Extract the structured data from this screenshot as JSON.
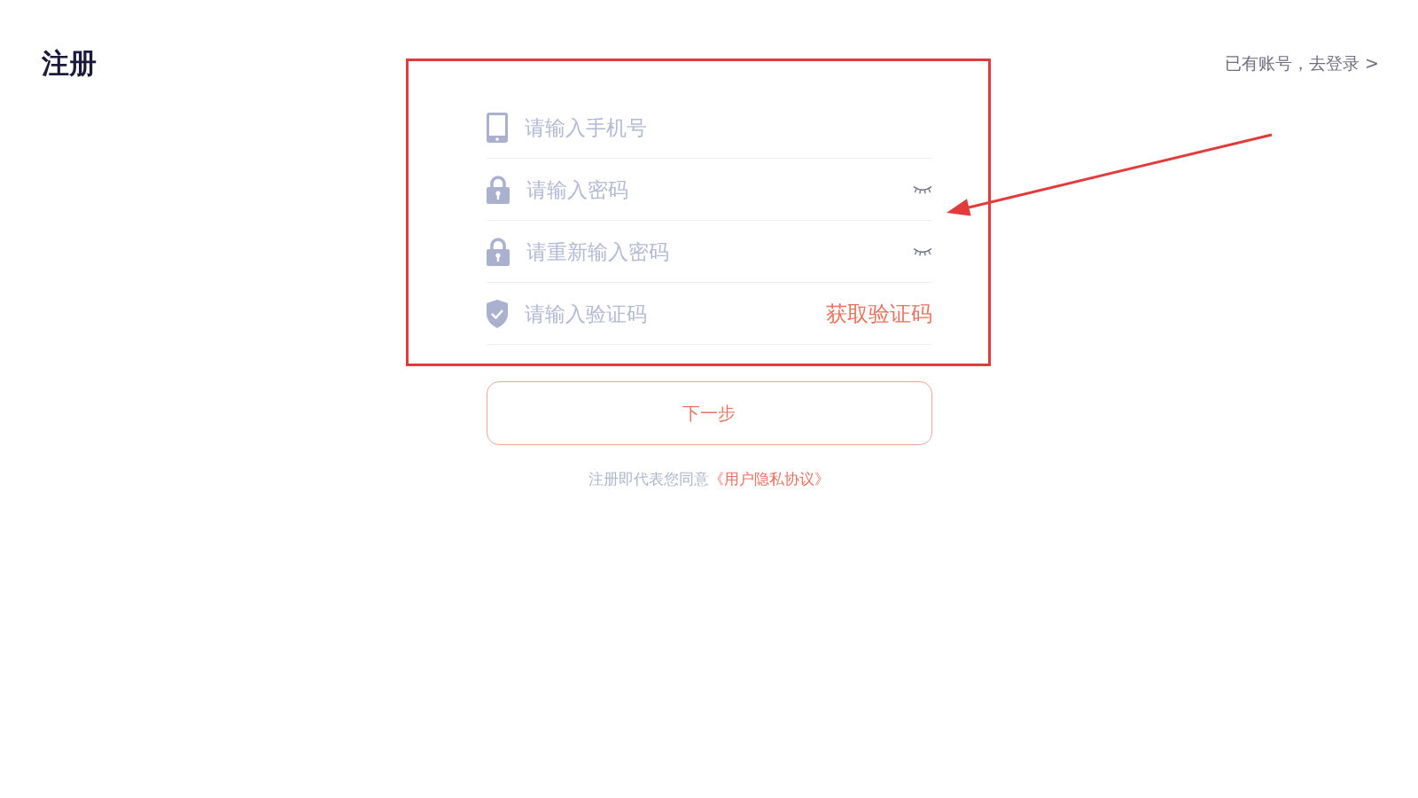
{
  "header": {
    "title": "注册",
    "login_link": "已有账号，去登录 >"
  },
  "form": {
    "fields": [
      {
        "kind": "phone",
        "placeholder": "请输入手机号"
      },
      {
        "kind": "password",
        "placeholder": "请输入密码",
        "revealed": false
      },
      {
        "kind": "password",
        "placeholder": "请重新输入密码",
        "revealed": false
      },
      {
        "kind": "code",
        "placeholder": "请输入验证码",
        "action": "获取验证码"
      }
    ],
    "submit": "下一步",
    "agreement": {
      "text": "注册即代表您同意",
      "link": "《用户隐私协议》"
    }
  }
}
